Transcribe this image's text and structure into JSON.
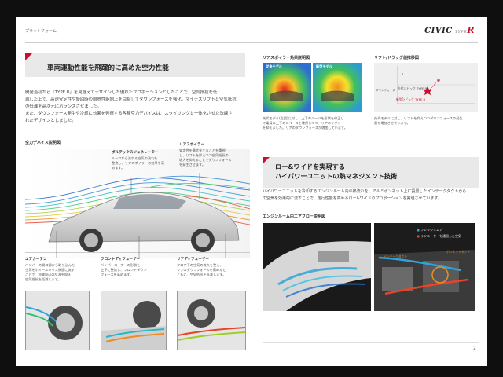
{
  "header": {
    "section": "プラットフォーム",
    "logo_main": "CIVIC",
    "logo_trim": "TYPE",
    "logo_r": "R"
  },
  "aero": {
    "title": "車両運動性能を飛躍的に高めた空力性能",
    "body": [
      "開発当初から「TYPE R」を見据えてデザインした優れたプロポーションとしたことで、空気抵抗を低",
      "減した上で、高速安定性や旋回時の限界性能向上を目指してダウンフォースを強化。マイナスリフトと空気抵抗",
      "の低減を高次元にバランスさせました。",
      "また、ダウンフォース発生や冷却に効果を発揮する各種空力デバイスは、スタイリングと一体化させた洗練さ",
      "れたデザインとしました。"
    ],
    "diagram_caption": "空力デバイス説明図",
    "callouts": {
      "vortex": {
        "title": "ボルテックスジェネレーター",
        "text": [
          "ルーフから流れる空気の流れを",
          "整流し、リアスポイラーの効果を高",
          "めます。"
        ]
      },
      "rear_spoiler": {
        "title": "リアスポイラー",
        "text": [
          "安定性を最大化することを重視",
          "し、リフトを抑えつつ空気抵抗の",
          "増大を抑えることでダウンフォース",
          "を発生させます。"
        ]
      },
      "air_curtain": {
        "title": "エアカーテン",
        "text": [
          "バンパーの開口部から取り込んだ",
          "空気をホイールハウス側面に流す",
          "ことで、前輪周辺の乱流を抑え",
          "空気抵抗を低減します。"
        ]
      },
      "front_diffuser": {
        "title": "フロントディフューザー",
        "text": [
          "バンパーコーナーの形状を",
          "上下に整流し、フロントダウン",
          "フォースを高めます。"
        ]
      },
      "rear_diffuser": {
        "title": "リアディフューザー",
        "text": [
          "フロア下の空気の流れを整え、",
          "リアのダウンフォースを高めると",
          "ともに、空気抵抗を低減します。"
        ]
      }
    }
  },
  "spoiler": {
    "caption": "リアスポイラー効果説明図",
    "label_old": "従来モデル",
    "label_new": "新型モデル",
    "text": [
      "先代モデル(左図)に対し、上下のパーツを形状を修正し",
      "て乗員の上下のスペースを確保しつつ、リアのリフト",
      "を抑えました。リアのダウンフォースが増加しています。"
    ]
  },
  "lift": {
    "caption": "リフト/ドラッグ値推移図",
    "legend_old": "先代シビック TYPE R",
    "legend_new": "新型シビック TYPE R",
    "axis_label": "ダウンフォース",
    "text": [
      "先代モデルに対し、リフトを抑えつつダウンフォースの発生",
      "量を増加させています。"
    ]
  },
  "heat": {
    "title_line1": "ロー&ワイドを実現する",
    "title_line2": "ハイパワーユニットの熱マネジメント技術",
    "body": [
      "ハイパワーユニットを冷却するエンジンルーム内の熱流れを、アルミボンネット上に設置したインテークダクトから",
      "の空気を効果的に流すことで、走行性能を高めるロー&ワイドのプロポーションを実現させています。"
    ],
    "caption": "エンジンルーム内エアフロー説明図",
    "legend_fresh": "フレッシュエア",
    "legend_hot": "ラジエーターを通過した空気",
    "label_intake": "インテークダクト",
    "label_vent": "ボンネットダクト"
  },
  "footer": {
    "page_number": "2"
  }
}
